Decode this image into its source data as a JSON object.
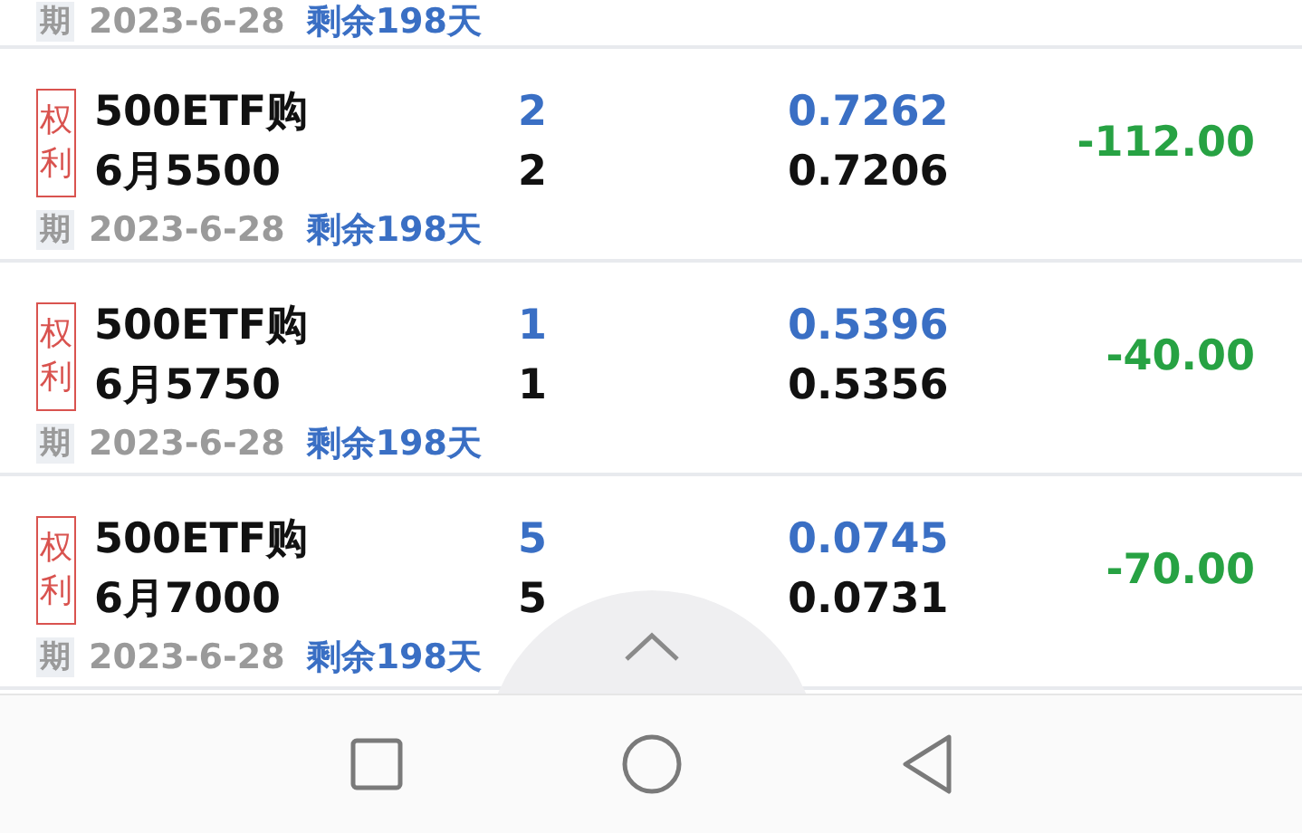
{
  "top_expiry": {
    "label": "期",
    "date": "2023-6-28",
    "remaining": "剩余198天"
  },
  "positions": [
    {
      "badge": "权利",
      "name": "500ETF购",
      "contract": "6月5500",
      "qty_1": "2",
      "qty_2": "2",
      "price_1": "0.7262",
      "price_2": "0.7206",
      "pnl": "-112.00",
      "expiry": {
        "label": "期",
        "date": "2023-6-28",
        "remaining": "剩余198天"
      }
    },
    {
      "badge": "权利",
      "name": "500ETF购",
      "contract": "6月5750",
      "qty_1": "1",
      "qty_2": "1",
      "price_1": "0.5396",
      "price_2": "0.5356",
      "pnl": "-40.00",
      "expiry": {
        "label": "期",
        "date": "2023-6-28",
        "remaining": "剩余198天"
      }
    },
    {
      "badge": "权利",
      "name": "500ETF购",
      "contract": "6月7000",
      "qty_1": "5",
      "qty_2": "5",
      "price_1": "0.0745",
      "price_2": "0.0731",
      "pnl": "-70.00",
      "expiry": {
        "label": "期",
        "date": "2023-6-28",
        "remaining": "剩余198天"
      }
    }
  ],
  "nav_buttons": [
    {
      "kind": "square"
    },
    {
      "kind": "circle"
    },
    {
      "kind": "triangle"
    }
  ]
}
